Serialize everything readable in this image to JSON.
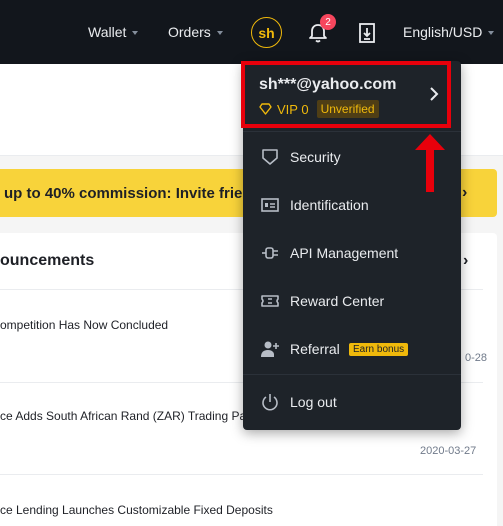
{
  "topbar": {
    "wallet": "Wallet",
    "orders": "Orders",
    "avatar_initials": "sh",
    "notification_count": "2",
    "language_currency": "English/USD"
  },
  "banner": {
    "text": "up to 40% commission: Invite frie",
    "chevron": "›"
  },
  "announcements": {
    "title": "ouncements",
    "chevron": "›",
    "items": [
      {
        "title": "ompetition Has Now Concluded",
        "date": "0-28"
      },
      {
        "title": "ce Adds South African Rand (ZAR) Trading Pai",
        "date": "2020-03-27"
      },
      {
        "title": "ce Lending Launches Customizable Fixed Deposits",
        "date": ""
      }
    ]
  },
  "account_menu": {
    "email": "sh***@yahoo.com",
    "vip": "VIP 0",
    "status": "Unverified",
    "items": [
      {
        "label": "Security",
        "icon": "shield-icon"
      },
      {
        "label": "Identification",
        "icon": "id-card-icon"
      },
      {
        "label": "API Management",
        "icon": "api-icon"
      },
      {
        "label": "Reward Center",
        "icon": "ticket-icon"
      },
      {
        "label": "Referral",
        "icon": "add-user-icon",
        "badge": "Earn bonus"
      }
    ],
    "logout": "Log out"
  },
  "colors": {
    "nav_bg": "#12161c",
    "menu_bg": "#1e2329",
    "brand_yellow": "#f0b90b",
    "annotation_red": "#e8000b"
  }
}
